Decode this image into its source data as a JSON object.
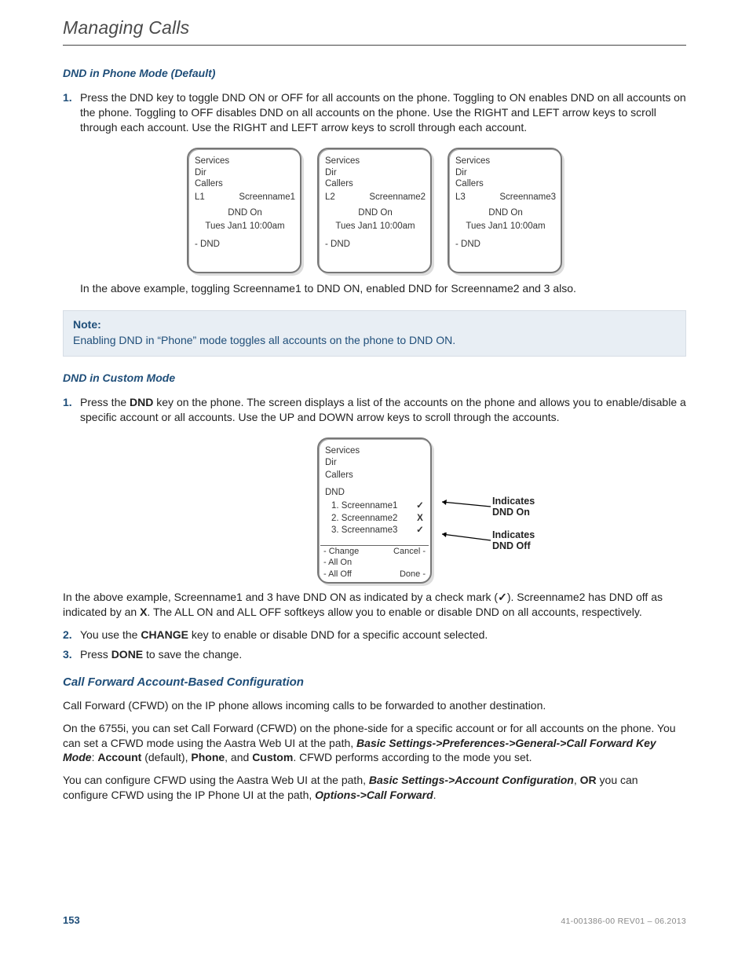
{
  "header": {
    "title": "Managing Calls"
  },
  "section_a": {
    "heading": "DND in Phone Mode (Default)",
    "step1_num": "1.",
    "step1_text": "Press the DND key to toggle DND ON or OFF for all accounts on the phone. Toggling to ON enables DND on all accounts on the phone. Toggling to OFF disables DND on all accounts on the phone. Use the RIGHT and LEFT arrow keys to scroll through each account. Use the RIGHT and LEFT arrow keys to scroll through each account.",
    "screens": [
      {
        "services": "Services",
        "dir": "Dir",
        "callers": "Callers",
        "line": "L1",
        "name": "Screenname1",
        "dnd": "DND On",
        "time": "Tues Jan1 10:00am",
        "softkey": "- DND"
      },
      {
        "services": "Services",
        "dir": "Dir",
        "callers": "Callers",
        "line": "L2",
        "name": "Screenname2",
        "dnd": "DND On",
        "time": "Tues Jan1 10:00am",
        "softkey": "- DND"
      },
      {
        "services": "Services",
        "dir": "Dir",
        "callers": "Callers",
        "line": "L3",
        "name": "Screenname3",
        "dnd": "DND On",
        "time": "Tues Jan1 10:00am",
        "softkey": "- DND"
      }
    ],
    "caption": "In the above example, toggling Screenname1 to DND ON, enabled DND for Screenname2 and 3 also."
  },
  "note": {
    "label": "Note:",
    "body": "Enabling DND in “Phone” mode toggles all accounts on the phone to DND ON."
  },
  "section_b": {
    "heading": "DND in Custom Mode",
    "step1_num": "1.",
    "step1_a": "Press the ",
    "step1_b_bold": "DND",
    "step1_c": " key on the phone. The screen displays a list of the accounts on the phone and allows you to enable/disable a specific account or all accounts. Use the UP and DOWN arrow keys to scroll through the accounts.",
    "screen": {
      "services": "Services",
      "dir": "Dir",
      "callers": "Callers",
      "dnd_title": "DND",
      "accounts": [
        {
          "label": "1.  Screenname1",
          "mark": "check"
        },
        {
          "label": "2.  Screenname2",
          "mark": "x"
        },
        {
          "label": "3.  Screenname3",
          "mark": "check"
        }
      ],
      "soft_left": [
        "- Change",
        "- All On",
        "- All Off"
      ],
      "soft_right": [
        "Cancel -",
        "",
        "Done -"
      ]
    },
    "callout_on": "Indicates\nDND On",
    "callout_off": "Indicates\nDND Off",
    "para_after_a": "In the above example, Screenname1 and 3 have DND ON as indicated by a check mark (",
    "para_after_b": "). Screenname2 has DND off as indicated by an ",
    "para_after_c_bold": "X",
    "para_after_d": ". The ALL ON and ALL OFF softkeys allow you to enable or disable DND on all accounts, respectively.",
    "step2_num": "2.",
    "step2_a": "You use the ",
    "step2_b_bold": "CHANGE",
    "step2_c": " key to enable or disable DND for a specific account selected.",
    "step3_num": "3.",
    "step3_a": "Press ",
    "step3_b_bold": "DONE",
    "step3_c": " to save the change."
  },
  "section_c": {
    "heading": "Call Forward Account-Based Configuration",
    "p1": "Call Forward (CFWD) on the IP phone allows incoming calls to be forwarded to another destination.",
    "p2_a": "On the 6755i, you can set Call Forward (CFWD) on the phone-side for a specific account or for all accounts on the phone. You can set a CFWD mode using the Aastra Web UI at the path, ",
    "p2_b_boldit": "Basic Settings->Preferences->General->Call Forward Key Mode",
    "p2_c": ": ",
    "p2_d_bold": "Account",
    "p2_e": " (default), ",
    "p2_f_bold": "Phone",
    "p2_g": ", and ",
    "p2_h_bold": "Custom",
    "p2_i": ". CFWD performs according to the mode you set.",
    "p3_a": "You can configure CFWD using the Aastra Web UI at the path, ",
    "p3_b_boldit": "Basic Settings->Account Configuration",
    "p3_c": ", ",
    "p3_d_bold": "OR",
    "p3_e": " you can configure CFWD using the IP Phone UI at the path, ",
    "p3_f_boldit": "Options->Call Forward",
    "p3_g": "."
  },
  "footer": {
    "page": "153",
    "docid": "41-001386-00 REV01 – 06.2013"
  }
}
